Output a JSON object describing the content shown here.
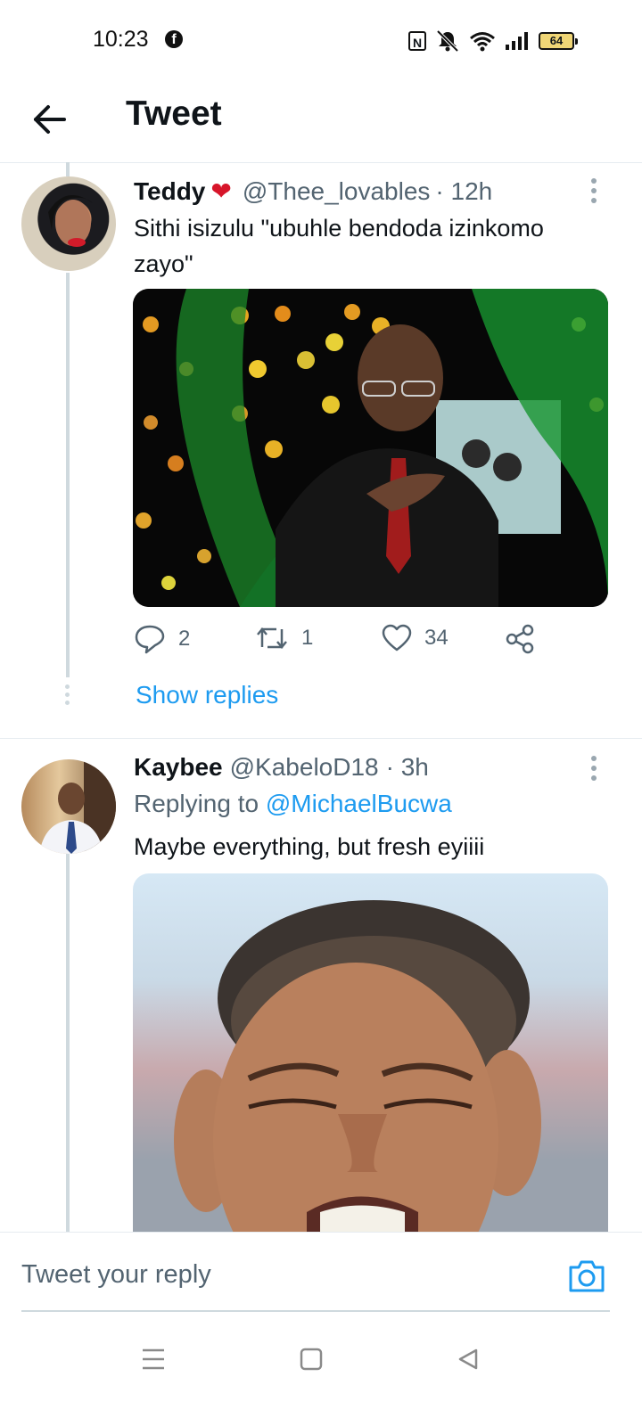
{
  "status_bar": {
    "time": "10:23",
    "battery": "64",
    "app_icon": "facebook-icon",
    "icons": [
      "nfc-icon",
      "mute-icon",
      "wifi-icon",
      "signal-icon",
      "battery-icon"
    ]
  },
  "header": {
    "title": "Tweet",
    "back_icon": "back-arrow-icon"
  },
  "tweets": [
    {
      "name": "Teddy",
      "name_emoji": "❤",
      "handle": "@Thee_lovables",
      "time": "· 12h",
      "text": "Sithi isizulu \"ubuhle bendoda izinkomo zayo\"",
      "replies": "2",
      "retweets": "1",
      "likes": "34",
      "show_replies": "Show replies"
    },
    {
      "name": "Kaybee",
      "handle": "@KabeloD18",
      "time": "· 3h",
      "replying_prefix": "Replying to",
      "replying_to": "@MichaelBucwa",
      "text": "Maybe everything, but fresh eyiiii"
    }
  ],
  "reply_box": {
    "placeholder": "Tweet your reply",
    "camera_icon": "camera-icon"
  },
  "nav_bar": {
    "icons": [
      "menu-icon",
      "home-icon",
      "back-icon"
    ]
  },
  "colors": {
    "accent": "#1d9bf0",
    "text": "#0f1419",
    "muted": "#536471"
  }
}
